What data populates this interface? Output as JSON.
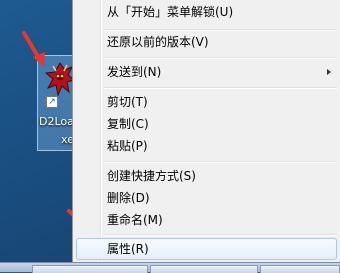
{
  "desktop": {
    "shortcut": {
      "label_line1": "D2Loa",
      "label_line2": "xe",
      "icon": "demon-game-icon",
      "overlay_icon": "shortcut-arrow-icon",
      "overlay_glyph": "↗"
    },
    "annotation_color": "#e8382e"
  },
  "context_menu": {
    "items": [
      {
        "label": "从「开始」菜单解锁(U)"
      },
      {
        "label": "还原以前的版本(V)"
      },
      {
        "label": "发送到(N)",
        "has_submenu": true
      },
      {
        "label": "剪切(T)"
      },
      {
        "label": "复制(C)"
      },
      {
        "label": "粘贴(P)"
      },
      {
        "label": "创建快捷方式(S)"
      },
      {
        "label": "删除(D)"
      },
      {
        "label": "重命名(M)"
      },
      {
        "label": "属性(R)",
        "highlighted": true
      }
    ]
  },
  "colors": {
    "menu_background": "#f0f0f0",
    "desktop_background": "#1e5a90",
    "highlight_border": "#a8c8ec"
  }
}
